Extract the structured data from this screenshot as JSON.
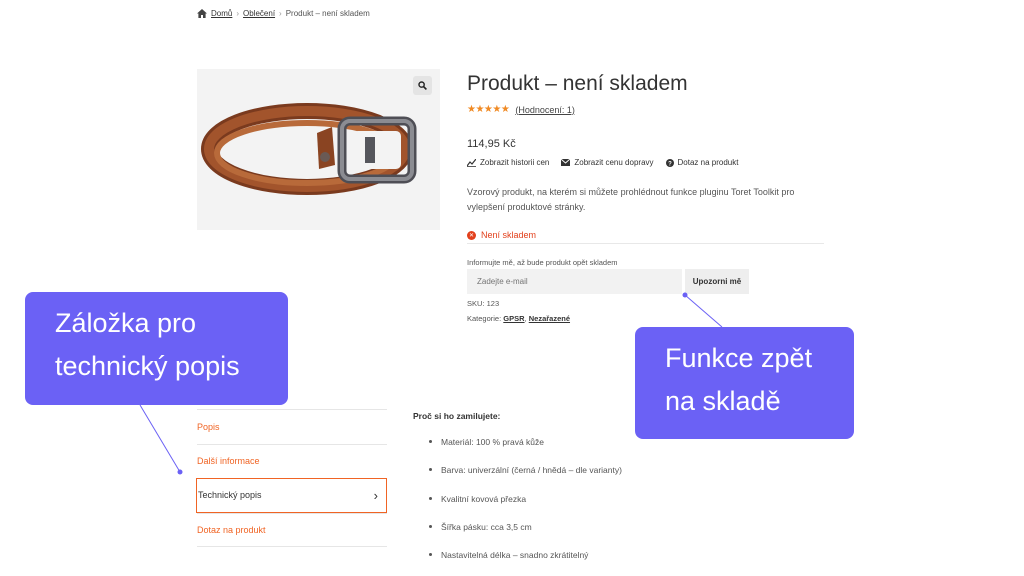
{
  "breadcrumb": {
    "home": "Domů",
    "category": "Oblečení",
    "current": "Produkt – není skladem"
  },
  "product": {
    "title": "Produkt – není skladem",
    "rating_stars": "★★★★★",
    "rating_link": "(Hodnocení: 1)",
    "price": "114,95 Kč",
    "links": {
      "history": "Zobrazit historii cen",
      "shipping": "Zobrazit cenu dopravy",
      "inquiry": "Dotaz na produkt"
    },
    "description": "Vzorový produkt, na kterém si můžete prohlédnout funkce pluginu Toret Toolkit pro vylepšení produktové stránky.",
    "stock_status": "Není skladem",
    "notify_label": "Informujte mě, až bude produkt opět skladem",
    "email_placeholder": "Zadejte e-mail",
    "notify_button": "Upozorni mě",
    "sku_label": "SKU:",
    "sku_value": "123",
    "categories_label": "Kategorie:",
    "categories": [
      "GPSR",
      "Nezařazené"
    ]
  },
  "tabs": [
    {
      "label": "Popis"
    },
    {
      "label": "Další informace"
    },
    {
      "label": "Technický popis",
      "chevron": "›"
    },
    {
      "label": "Dotaz na produkt"
    }
  ],
  "content": {
    "heading": "Proč si ho zamilujete:",
    "items": [
      "Materiál: 100 % pravá kůže",
      "Barva: univerzální (černá / hnědá – dle varianty)",
      "Kvalitní kovová přezka",
      "Šířka pásku: cca 3,5 cm",
      "Nastavitelná délka – snadno zkrátitelný"
    ]
  },
  "callouts": {
    "left": [
      "Záložka pro",
      "technický popis"
    ],
    "right": [
      "Funkce zpět",
      "na skladě"
    ]
  },
  "colors": {
    "accent": "#f06424",
    "callout": "#6b61f5",
    "stock": "#e2401c",
    "star": "#f08a24"
  }
}
